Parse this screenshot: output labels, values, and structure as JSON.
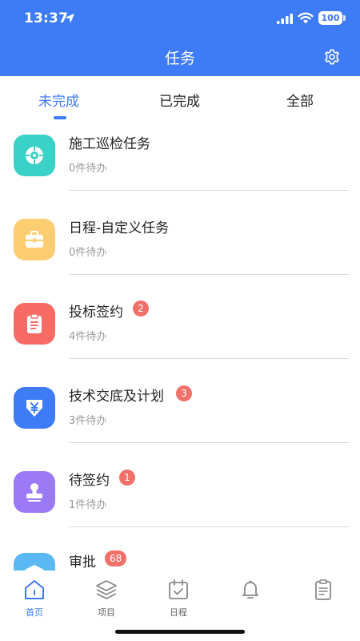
{
  "status_bar": {
    "time": "13:37",
    "battery": "100"
  },
  "header": {
    "title": "任务"
  },
  "tabs": [
    {
      "label": "未完成",
      "active": true
    },
    {
      "label": "已完成",
      "active": false
    },
    {
      "label": "全部",
      "active": false
    }
  ],
  "tasks": [
    {
      "title": "施工巡检任务",
      "subtitle": "0件待办",
      "badge": "",
      "icon": "target-icon",
      "color": "#3ad1c6"
    },
    {
      "title": "日程-自定义任务",
      "subtitle": "0件待办",
      "badge": "",
      "icon": "briefcase-icon",
      "color": "#fccd71"
    },
    {
      "title": "投标签约",
      "subtitle": "4件待办",
      "badge": "2",
      "icon": "clipboard-icon",
      "color": "#f86b65"
    },
    {
      "title": "技术交底及计划",
      "subtitle": "3件待办",
      "badge": "3",
      "icon": "yen-shield-icon",
      "color": "#3d7bf7"
    },
    {
      "title": "待签约",
      "subtitle": "1件待办",
      "badge": "1",
      "icon": "stamp-icon",
      "color": "#9d7af5"
    },
    {
      "title": "审批",
      "subtitle": "",
      "badge": "68",
      "icon": "stack-icon",
      "color": "#5ab8f3"
    }
  ],
  "bottom_nav": [
    {
      "label": "首页",
      "icon": "home-icon",
      "active": true
    },
    {
      "label": "项目",
      "icon": "layers-icon",
      "active": false
    },
    {
      "label": "日程",
      "icon": "calendar-icon",
      "active": false
    },
    {
      "label": "",
      "icon": "bell-icon",
      "active": false
    },
    {
      "label": "",
      "icon": "document-icon",
      "active": false
    }
  ],
  "colors": {
    "primary": "#3d7bf7",
    "badge": "#f0706a"
  }
}
